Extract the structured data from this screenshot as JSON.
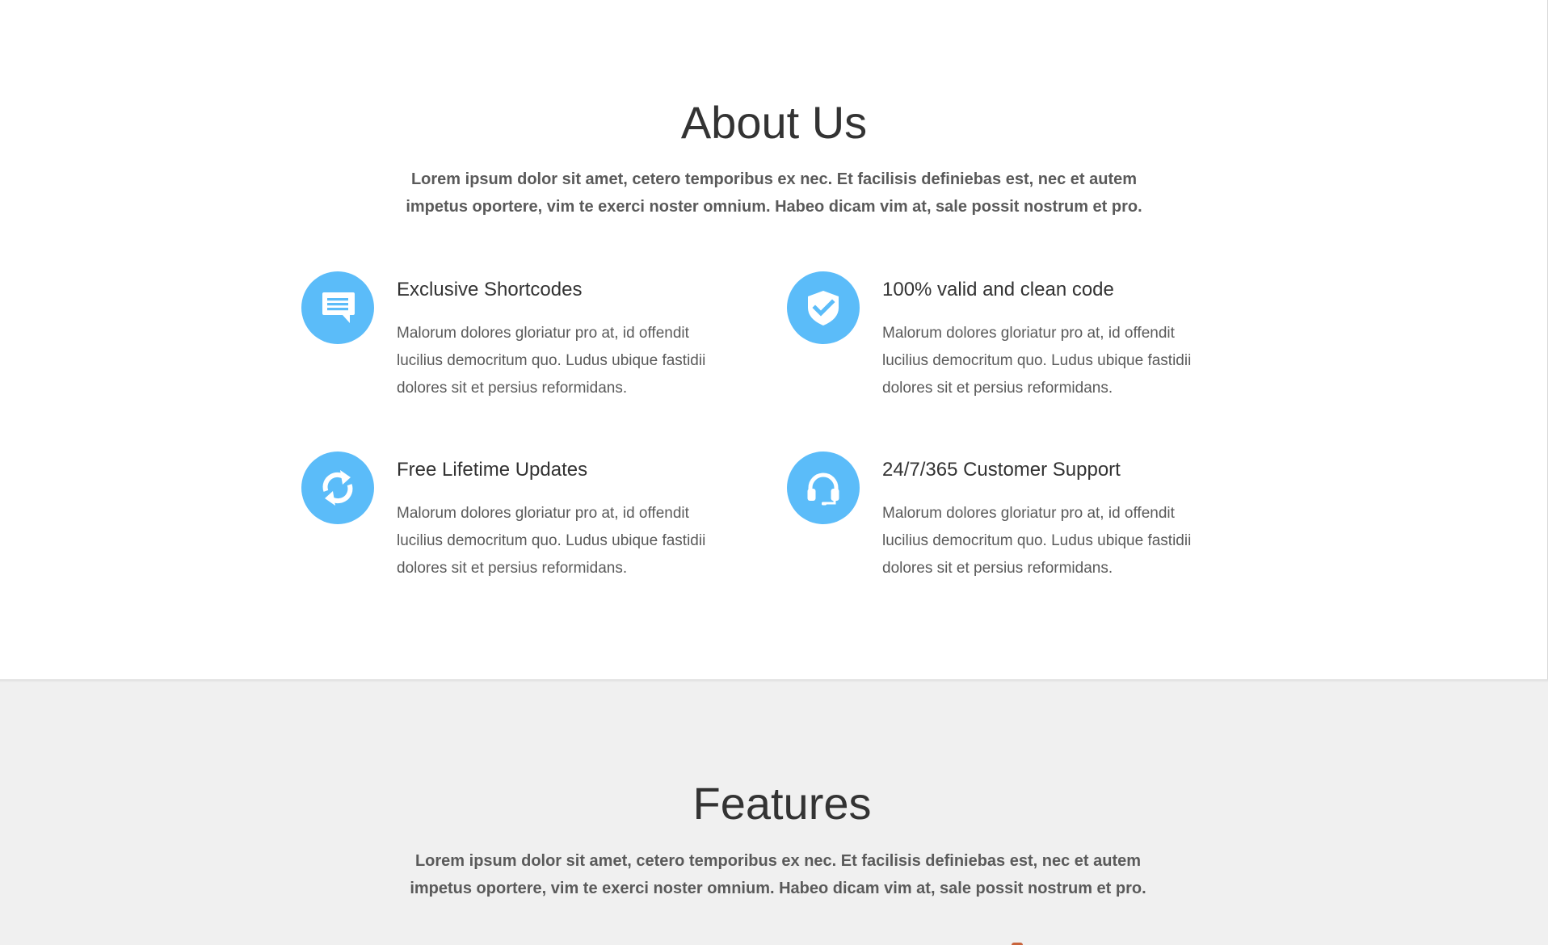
{
  "about": {
    "title": "About Us",
    "intro": "Lorem ipsum dolor sit amet, cetero temporibus ex nec. Et facilisis definiebas est, nec et autem impetus oportere, vim te exerci noster omnium. Habeo dicam vim at, sale possit nostrum et pro.",
    "features": [
      {
        "icon": "chat-icon",
        "title": "Exclusive Shortcodes",
        "text": "Malorum dolores gloriatur pro at, id offendit lucilius democritum quo. Ludus ubique fastidii dolores sit et persius reformidans."
      },
      {
        "icon": "shield-check-icon",
        "title": "100% valid and clean code",
        "text": "Malorum dolores gloriatur pro at, id offendit lucilius democritum quo. Ludus ubique fastidii dolores sit et persius reformidans."
      },
      {
        "icon": "refresh-icon",
        "title": "Free Lifetime Updates",
        "text": "Malorum dolores gloriatur pro at, id offendit lucilius democritum quo. Ludus ubique fastidii dolores sit et persius reformidans."
      },
      {
        "icon": "headset-icon",
        "title": "24/7/365 Customer Support",
        "text": "Malorum dolores gloriatur pro at, id offendit lucilius democritum quo. Ludus ubique fastidii dolores sit et persius reformidans."
      }
    ]
  },
  "features_section": {
    "title": "Features",
    "intro": "Lorem ipsum dolor sit amet, cetero temporibus ex nec. Et facilisis definiebas est, nec et autem impetus oportere, vim te exerci noster omnium. Habeo dicam vim at, sale possit nostrum et pro."
  },
  "colors": {
    "accent": "#5bbcf9",
    "heading": "#333333",
    "body_text": "#5a5a5a",
    "about_background": "#ffffff",
    "features_background": "#f0f0f0"
  }
}
